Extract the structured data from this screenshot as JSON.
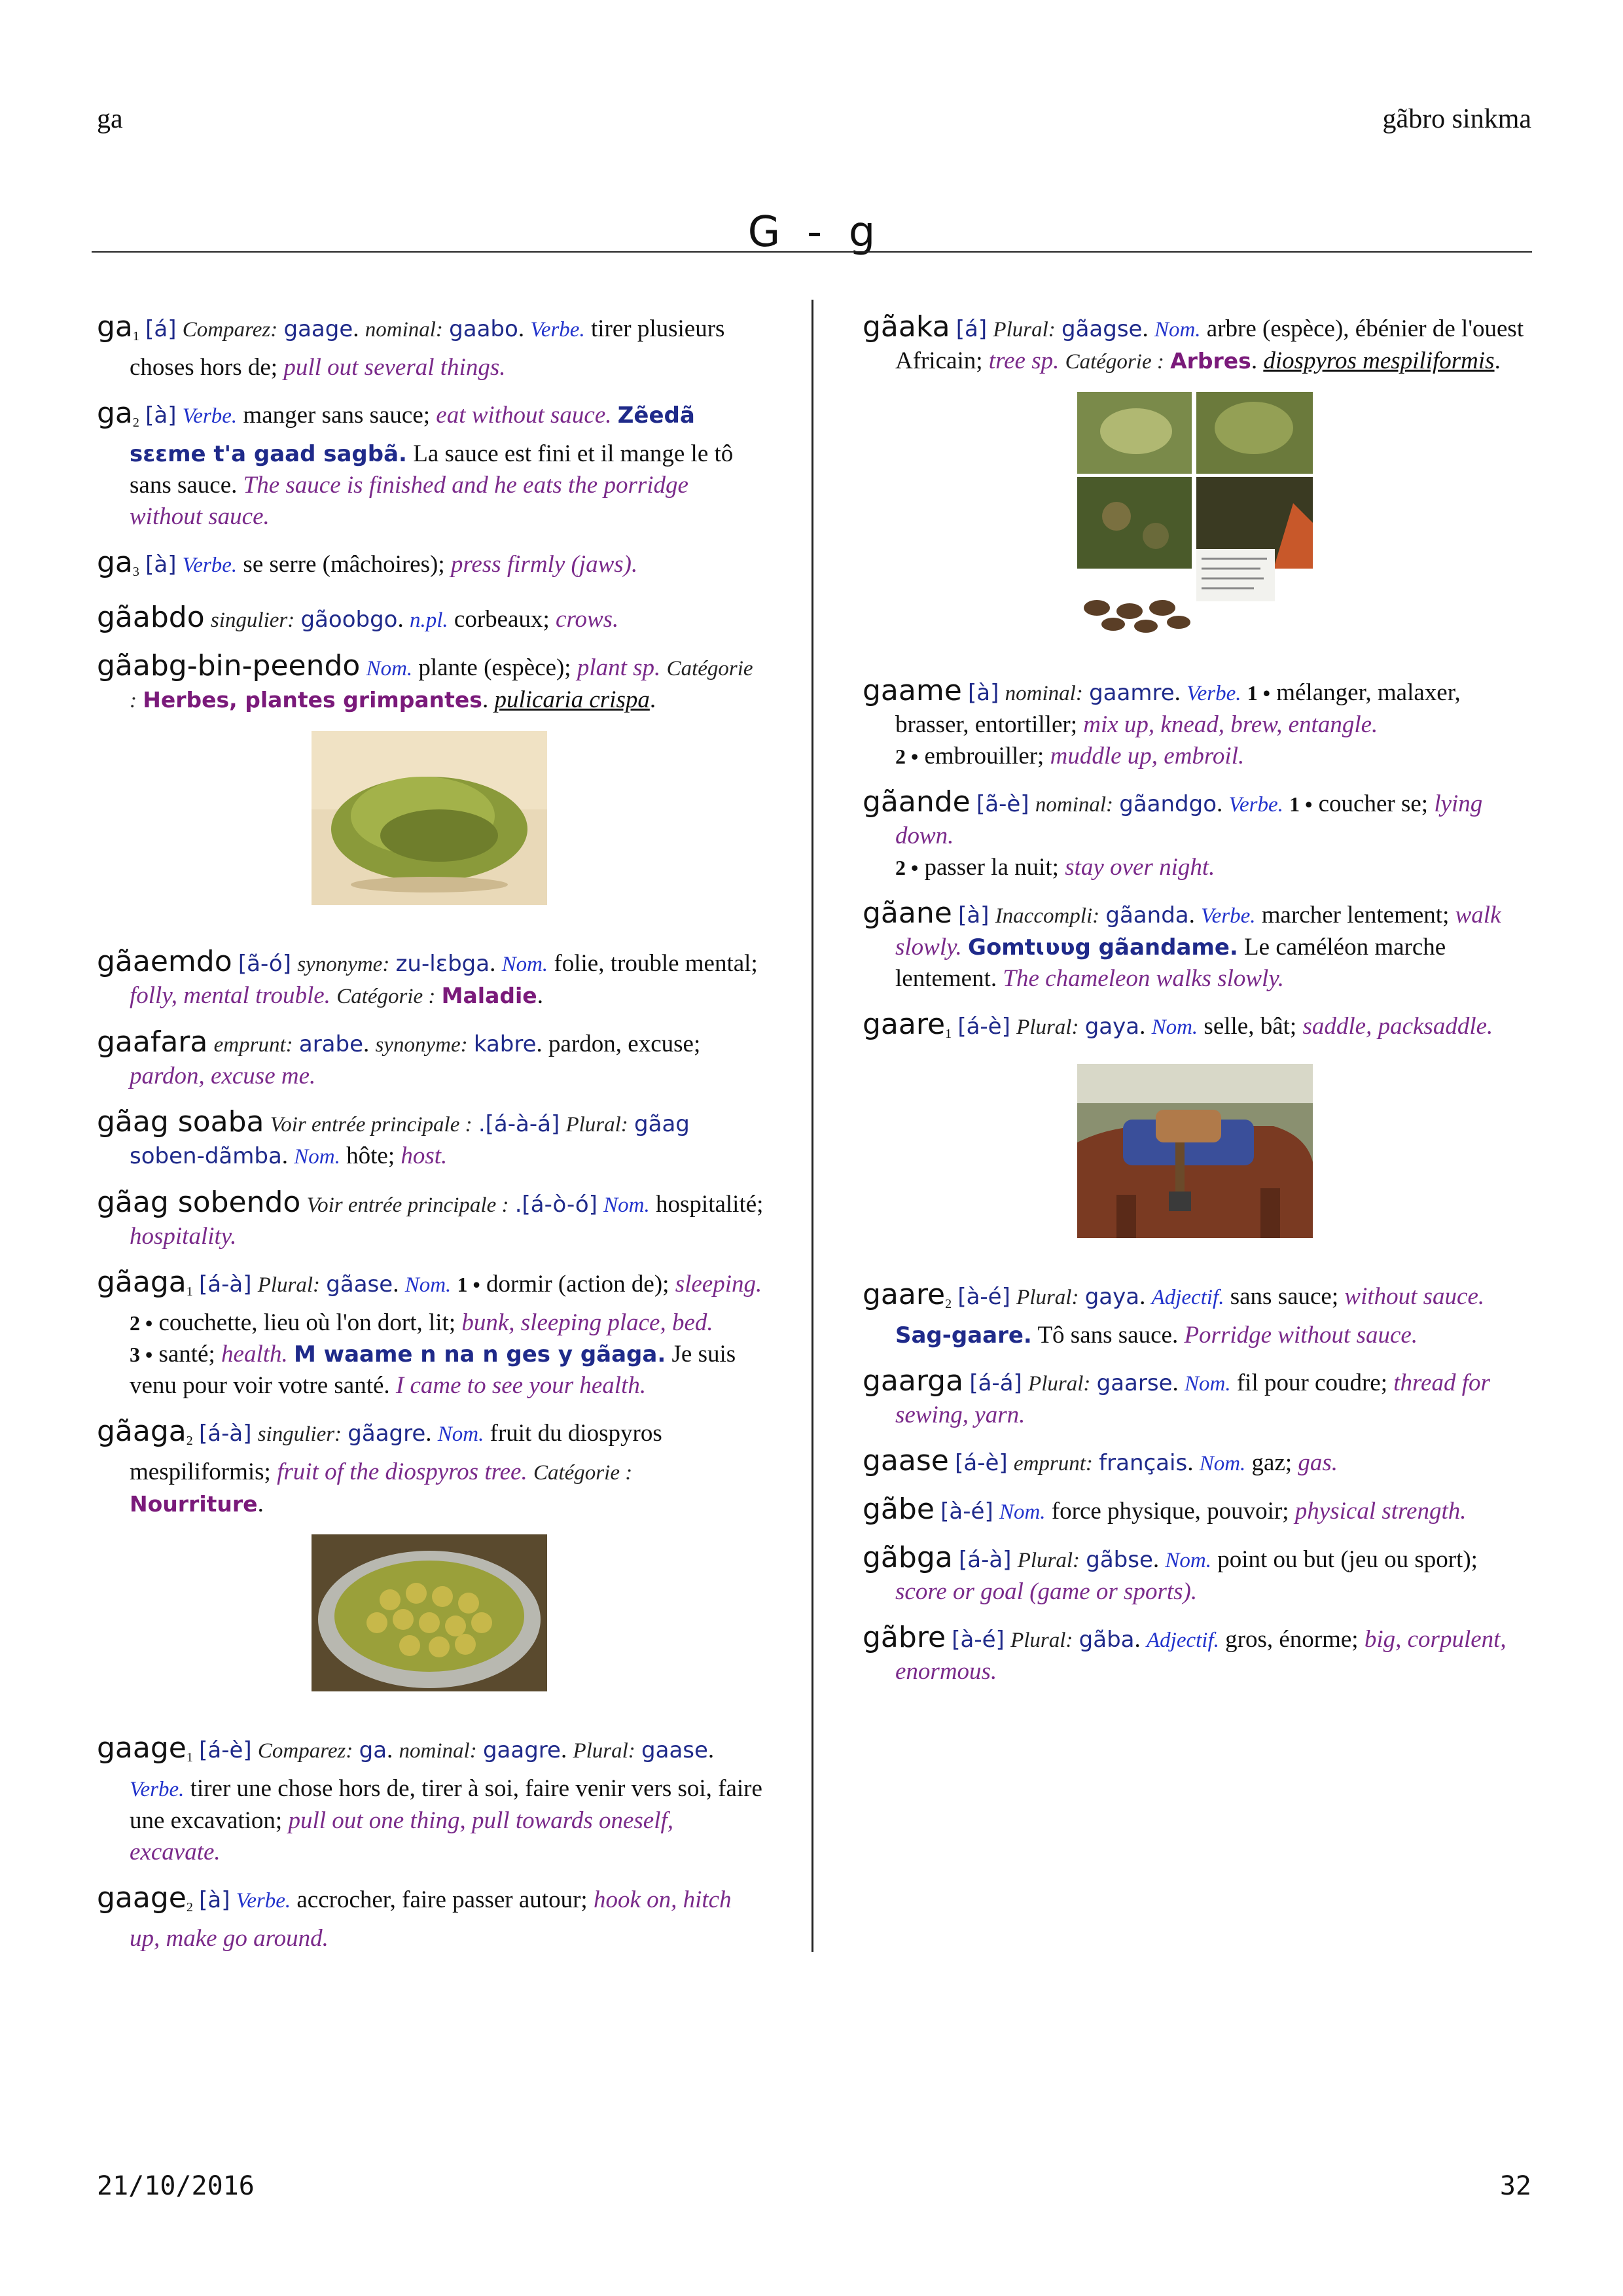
{
  "header": {
    "left": "ga",
    "right": "gãbro sinkma"
  },
  "section_title": "G  -  g",
  "footer": {
    "date": "21/10/2016",
    "page": "32"
  },
  "left": {
    "e1": {
      "hw": "ga",
      "hom": "1",
      "tone": "[á]",
      "cmp": "Comparez:",
      "cmp_ref": "gaage",
      "nom": "nominal:",
      "nom_ref": "gaabo",
      "pos": "Verbe.",
      "fr": "tirer plusieurs choses hors de;",
      "en": "pull out several things."
    },
    "e2": {
      "hw": "ga",
      "hom": "2",
      "tone": "[à]",
      "pos": "Verbe.",
      "fr": "manger sans sauce;",
      "en": "eat without sauce.",
      "ex": "Zẽedã sɛɛme t'a gaad sagbã.",
      "ex_fr": "La sauce est fini et il mange le tô sans sauce.",
      "ex_en": "The sauce is finished and he eats the porridge without sauce."
    },
    "e3": {
      "hw": "ga",
      "hom": "3",
      "tone": "[à]",
      "pos": "Verbe.",
      "fr": "se serre (mâchoires);",
      "en": "press firmly (jaws)."
    },
    "e4": {
      "hw": "gãabdo",
      "sg": "singulier:",
      "sg_ref": "gãoobgo",
      "pos": "n.pl.",
      "fr": "corbeaux;",
      "en": "crows."
    },
    "e5": {
      "hw": "gãabg-bin-peendo",
      "pos": "Nom.",
      "fr": "plante (espèce);",
      "en": "plant sp.",
      "cat_label": "Catégorie :",
      "cat": "Herbes, plantes grimpantes",
      "sci": "pulicaria crispa"
    },
    "e6": {
      "hw": "gãaemdo",
      "tone": "[ã-ó]",
      "syn": "synonyme:",
      "syn_ref": "zu-lɛbga",
      "pos": "Nom.",
      "fr": "folie, trouble mental;",
      "en": "folly, mental trouble.",
      "cat_label": "Catégorie :",
      "cat": "Maladie"
    },
    "e7": {
      "hw": "gaafara",
      "emp": "emprunt:",
      "emp_ref": "arabe",
      "syn": "synonyme:",
      "syn_ref": "kabre",
      "fr": "pardon, excuse;",
      "en": "pardon, excuse me."
    },
    "e8": {
      "hw": "gãag soaba",
      "main": "Voir entrée principale :",
      "main_ref": ".[á-à-á]",
      "pl": "Plural:",
      "pl_ref": "gãag soben-dãmba",
      "pos": "Nom.",
      "fr": "hôte;",
      "en": "host."
    },
    "e9": {
      "hw": "gãag sobendo",
      "main": "Voir entrée principale :",
      "main_ref": ".[á-ò-ó]",
      "pos": "Nom.",
      "fr": "hospitalité;",
      "en": "hospitality."
    },
    "e10": {
      "hw": "gãaga",
      "hom": "1",
      "tone": "[á-à]",
      "pl": "Plural:",
      "pl_ref": "gãase",
      "pos": "Nom.",
      "s1_num": "1 •",
      "s1_fr": "dormir (action de);",
      "s1_en": "sleeping.",
      "s2_num": "2 •",
      "s2_fr": "couchette, lieu où l'on dort, lit;",
      "s2_en": "bunk, sleeping place, bed.",
      "s3_num": "3 •",
      "s3_fr": "santé;",
      "s3_en": "health.",
      "ex": "M waame n na n ges y gãaga.",
      "ex_fr": "Je suis venu pour voir votre santé.",
      "ex_en": "I came to see your health."
    },
    "e11": {
      "hw": "gãaga",
      "hom": "2",
      "tone": "[á-à]",
      "sg": "singulier:",
      "sg_ref": "gãagre",
      "pos": "Nom.",
      "fr": "fruit du diospyros mespiliformis;",
      "en": "fruit of the diospyros tree.",
      "cat_label": "Catégorie :",
      "cat": "Nourriture"
    },
    "e12": {
      "hw": "gaage",
      "hom": "1",
      "tone": "[á-è]",
      "cmp": "Comparez:",
      "cmp_ref": "ga",
      "nom": "nominal:",
      "nom_ref": "gaagre",
      "pl": "Plural:",
      "pl_ref": "gaase",
      "pos": "Verbe.",
      "fr": "tirer une chose hors de, tirer à soi, faire venir vers soi, faire une excavation;",
      "en": "pull out one thing, pull towards oneself, excavate."
    },
    "e13": {
      "hw": "gaage",
      "hom": "2",
      "tone": "[à]",
      "pos": "Verbe.",
      "fr": "accrocher, faire passer autour;",
      "en": "hook on, hitch up, make go around."
    }
  },
  "right": {
    "e1": {
      "hw": "gãaka",
      "tone": "[á]",
      "pl": "Plural:",
      "pl_ref": "gãagse",
      "pos": "Nom.",
      "fr": "arbre (espèce), ébénier de l'ouest Africain;",
      "en": "tree sp.",
      "cat_label": "Catégorie :",
      "cat": "Arbres",
      "sci": "diospyros mespiliformis"
    },
    "e2": {
      "hw": "gaame",
      "tone": "[à]",
      "nom": "nominal:",
      "nom_ref": "gaamre",
      "pos": "Verbe.",
      "s1_num": "1 •",
      "s1_fr": "mélanger, malaxer, brasser, entortiller;",
      "s1_en": "mix up, knead, brew, entangle.",
      "s2_num": "2 •",
      "s2_fr": "embrouiller;",
      "s2_en": "muddle up, embroil."
    },
    "e3": {
      "hw": "gãande",
      "tone": "[ã-è]",
      "nom": "nominal:",
      "nom_ref": "gãandgo",
      "pos": "Verbe.",
      "s1_num": "1 •",
      "s1_fr": "coucher se;",
      "s1_en": "lying down.",
      "s2_num": "2 •",
      "s2_fr": "passer la nuit;",
      "s2_en": "stay over night."
    },
    "e4": {
      "hw": "gãane",
      "tone": "[à]",
      "inc": "Inaccompli:",
      "inc_ref": "gãanda",
      "pos": "Verbe.",
      "fr": "marcher lentement;",
      "en": "walk slowly.",
      "ex": "Gomtɩʋʋg gãandame.",
      "ex_fr": "Le caméléon marche lentement.",
      "ex_en": "The chameleon walks slowly."
    },
    "e5": {
      "hw": "gaare",
      "hom": "1",
      "tone": "[á-è]",
      "pl": "Plural:",
      "pl_ref": "gaya",
      "pos": "Nom.",
      "fr": "selle, bât;",
      "en": "saddle, packsaddle."
    },
    "e6": {
      "hw": "gaare",
      "hom": "2",
      "tone": "[à-é]",
      "pl": "Plural:",
      "pl_ref": "gaya",
      "pos": "Adjectif.",
      "fr": "sans sauce;",
      "en": "without sauce.",
      "ex": "Sag-gaare.",
      "ex_fr": "Tô sans sauce.",
      "ex_en": "Porridge without sauce."
    },
    "e7": {
      "hw": "gaarga",
      "tone": "[á-á]",
      "pl": "Plural:",
      "pl_ref": "gaarse",
      "pos": "Nom.",
      "fr": "fil pour coudre;",
      "en": "thread for sewing, yarn."
    },
    "e8": {
      "hw": "gaase",
      "tone": "[á-è]",
      "emp": "emprunt:",
      "emp_ref": "français",
      "pos": "Nom.",
      "fr": "gaz;",
      "en": "gas."
    },
    "e9": {
      "hw": "gãbe",
      "tone": "[à-é]",
      "pos": "Nom.",
      "fr": "force physique, pouvoir;",
      "en": "physical strength."
    },
    "e10": {
      "hw": "gãbga",
      "tone": "[á-à]",
      "pl": "Plural:",
      "pl_ref": "gãbse",
      "pos": "Nom.",
      "fr": "point ou but (jeu ou sport);",
      "en": "score or goal (game or sports)."
    },
    "e11": {
      "hw": "gãbre",
      "tone": "[à-é]",
      "pl": "Plural:",
      "pl_ref": "gãba",
      "pos": "Adjectif.",
      "fr": "gros, énorme;",
      "en": "big, corpulent, enormous."
    }
  }
}
